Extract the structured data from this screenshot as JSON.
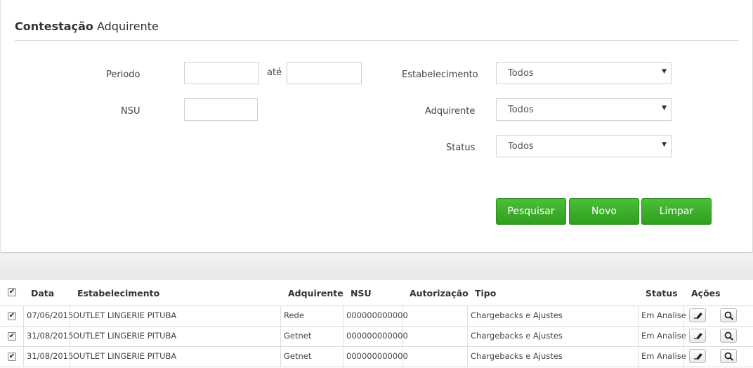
{
  "header": {
    "title_bold": "Contestação",
    "title_rest": "Adquirente"
  },
  "filters": {
    "periodo_label": "Periodo",
    "ate_label": "até",
    "nsu_label": "NSU",
    "estabelecimento_label": "Estabelecimento",
    "estabelecimento_value": "Todos",
    "adquirente_label": "Adquirente",
    "adquirente_value": "Todos",
    "status_label": "Status",
    "status_value": "Todos"
  },
  "buttons": {
    "pesquisar": "Pesquisar",
    "novo": "Novo",
    "limpar": "Limpar"
  },
  "table": {
    "headers": {
      "data": "Data",
      "estabelecimento": "Estabelecimento",
      "adquirente": "Adquirente",
      "nsu": "NSU",
      "autorizacao": "Autorização",
      "tipo": "Tipo",
      "status": "Status",
      "acoes": "Ações"
    },
    "rows": [
      {
        "data": "07/06/2015",
        "estabelecimento": "OUTLET LINGERIE PITUBA",
        "adquirente": "Rede",
        "nsu": "000000000000",
        "autorizacao": "",
        "tipo": "Chargebacks e Ajustes",
        "status": "Em Analise"
      },
      {
        "data": "31/08/2015",
        "estabelecimento": "OUTLET LINGERIE PITUBA",
        "adquirente": "Getnet",
        "nsu": "000000000000",
        "autorizacao": "",
        "tipo": "Chargebacks e Ajustes",
        "status": "Em Analise"
      },
      {
        "data": "31/08/2015",
        "estabelecimento": "OUTLET LINGERIE PITUBA",
        "adquirente": "Getnet",
        "nsu": "000000000000",
        "autorizacao": "",
        "tipo": "Chargebacks e Ajustes",
        "status": "Em Analise"
      }
    ]
  },
  "icons": {
    "edit": "eraser-icon",
    "view": "search-icon",
    "dropdown": "caret-down-icon",
    "check": "check-icon"
  },
  "colors": {
    "button_green": "#3aae29",
    "page_bg": "#e6e6e6"
  }
}
